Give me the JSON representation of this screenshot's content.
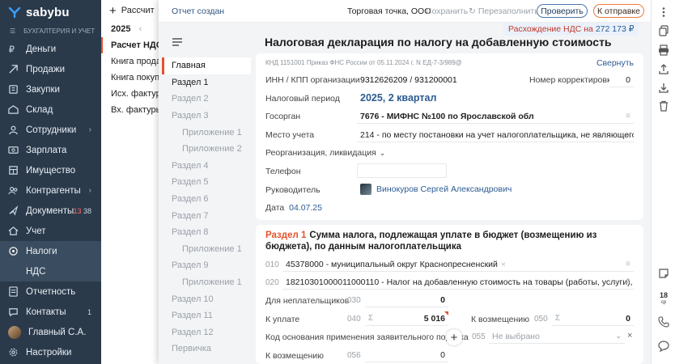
{
  "app": {
    "name": "sabybu",
    "subtitle": "БУХГАЛТЕРИЯ И УЧЕТ"
  },
  "colors": {
    "sidebar": "#2a3a4b",
    "accent": "#e4532b",
    "link": "#2c5b92",
    "alert": "#c0392b"
  },
  "sidebar": {
    "items": [
      {
        "label": "Деньги",
        "icon": "money-icon"
      },
      {
        "label": "Продажи",
        "icon": "sales-icon"
      },
      {
        "label": "Закупки",
        "icon": "purchases-icon"
      },
      {
        "label": "Склад",
        "icon": "warehouse-icon"
      },
      {
        "label": "Сотрудники",
        "icon": "employees-icon"
      },
      {
        "label": "Зарплата",
        "icon": "salary-icon"
      },
      {
        "label": "Имущество",
        "icon": "property-icon"
      },
      {
        "label": "Контрагенты",
        "icon": "contractors-icon"
      },
      {
        "label": "Документы",
        "icon": "documents-icon",
        "count_red": "13",
        "count": "38"
      },
      {
        "label": "Учет",
        "icon": "accounting-icon"
      },
      {
        "label": "Налоги",
        "icon": "taxes-icon"
      },
      {
        "label": "НДС"
      },
      {
        "label": "Отчетность",
        "icon": "reports-icon"
      },
      {
        "label": "Контакты",
        "icon": "contacts-icon",
        "count": "1"
      },
      {
        "label": "Главный С.А."
      },
      {
        "label": "Настройки",
        "icon": "settings-icon"
      }
    ]
  },
  "mid": {
    "create_label": "Рассчит",
    "year": "2025",
    "list": [
      "Расчет НДС",
      "Книга прода",
      "Книга покупо",
      "Исх. фактуры",
      "Вх. фактуры"
    ]
  },
  "toolbar": {
    "status": "Отчет создан",
    "org": "Торговая точка, ООО",
    "save": "Сохранить",
    "refill": "Перезаполнить",
    "check": "Проверить",
    "send": "К отправке",
    "diff_label": "Расхождение НДС на",
    "diff_value": "272 173 ₽"
  },
  "doc_nav": {
    "items": [
      {
        "label": "Главная",
        "level": 0,
        "state": "active"
      },
      {
        "label": "Раздел 1",
        "level": 0,
        "state": "dark"
      },
      {
        "label": "Раздел 2",
        "level": 0,
        "state": ""
      },
      {
        "label": "Раздел 3",
        "level": 0,
        "state": ""
      },
      {
        "label": "Приложение 1",
        "level": 1,
        "state": ""
      },
      {
        "label": "Приложение 2",
        "level": 1,
        "state": ""
      },
      {
        "label": "Раздел 4",
        "level": 0,
        "state": ""
      },
      {
        "label": "Раздел 5",
        "level": 0,
        "state": ""
      },
      {
        "label": "Раздел 6",
        "level": 0,
        "state": ""
      },
      {
        "label": "Раздел 7",
        "level": 0,
        "state": ""
      },
      {
        "label": "Раздел 8",
        "level": 0,
        "state": ""
      },
      {
        "label": "Приложение 1",
        "level": 1,
        "state": ""
      },
      {
        "label": "Раздел 9",
        "level": 0,
        "state": ""
      },
      {
        "label": "Приложение 1",
        "level": 1,
        "state": ""
      },
      {
        "label": "Раздел 10",
        "level": 0,
        "state": ""
      },
      {
        "label": "Раздел 11",
        "level": 0,
        "state": ""
      },
      {
        "label": "Раздел 12",
        "level": 0,
        "state": ""
      },
      {
        "label": "Первичка",
        "level": 0,
        "state": ""
      }
    ]
  },
  "doc": {
    "title": "Налоговая декларация по налогу на добавленную стоимость",
    "meta": "КНД 1151001 Приказ ФНС России от 05.11.2024 г. N ЕД-7-3/989@",
    "collapse": "Свернуть",
    "inn_label": "ИНН / КПП организации",
    "inn": "9312626209",
    "kpp_sep": "/",
    "kpp": "931200001",
    "correction_label": "Номер корректировки",
    "correction": "0",
    "period_label": "Налоговый период",
    "period": "2025, 2 квартал",
    "gosorgan_label": "Госорган",
    "gosorgan": "7676 - МИФНС №100 по Ярославской обл",
    "place_label": "Место учета",
    "place": "214 - по месту постановки на учет налогоплательщика, не являющегося к...",
    "reorg_label": "Реорганизация, ликвидация",
    "phone_label": "Телефон",
    "phone": "",
    "head_label": "Руководитель",
    "head": "Винокуров Сергей Александрович",
    "date_label": "Дата",
    "date": "04.07.25"
  },
  "section1": {
    "number": "Раздел 1",
    "title": "Сумма налога, подлежащая уплате в бюджет (возмещению из бюджета), по данным налогоплательщика",
    "code010": "010",
    "oktmo": "45378000 - муниципальный округ Краснопресненский",
    "code020": "020",
    "kbk": "18210301000011000110 - Налог на добавленную стоимость на товары (работы, услуги), реал...",
    "nonpayer_label": "Для неплательщиков",
    "code030": "030",
    "nonpayer": "0",
    "pay_label": "К уплате",
    "code040": "040",
    "pay": "5 016",
    "refund_label": "К возмещению",
    "code050": "050",
    "refund": "0",
    "basis_label": "Код основания применения заявительного порядка",
    "code055": "055",
    "basis_placeholder": "Не выбрано",
    "refund2_label": "К возмещению",
    "code056": "056",
    "refund2": "0"
  },
  "rightbar": {
    "date_num": "18",
    "date_mon": "ср"
  }
}
